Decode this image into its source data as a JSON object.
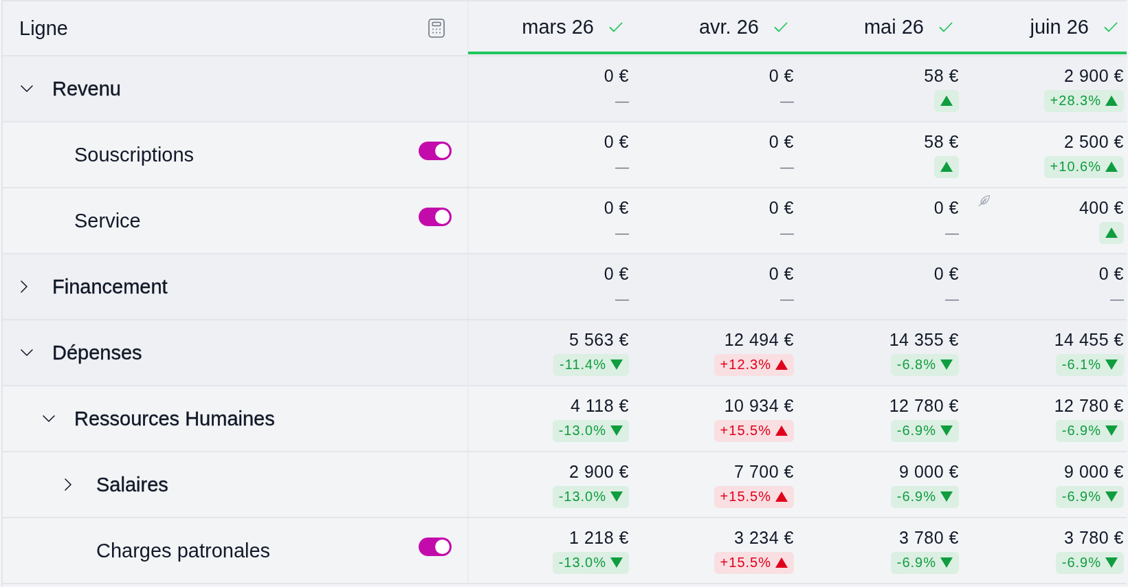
{
  "table": {
    "header": {
      "label": "Ligne"
    },
    "months": [
      {
        "label": "mars 26",
        "validated": true
      },
      {
        "label": "avr. 26",
        "validated": true
      },
      {
        "label": "mai 26",
        "validated": true
      },
      {
        "label": "juin 26",
        "validated": true
      }
    ],
    "rows": [
      {
        "label": "Revenu",
        "kind": "group",
        "expanded": true,
        "cells": [
          {
            "value": "0 €",
            "trend": {
              "kind": "none",
              "text": "—"
            },
            "edited": false
          },
          {
            "value": "0 €",
            "trend": {
              "kind": "none",
              "text": "—"
            },
            "edited": false
          },
          {
            "value": "58 €",
            "trend": {
              "kind": "up",
              "favorable": true
            },
            "edited": false
          },
          {
            "value": "2 900 €",
            "trend": {
              "kind": "up",
              "favorable": true,
              "text": "+28.3%"
            },
            "edited": false
          }
        ],
        "children": [
          {
            "label": "Souscriptions",
            "kind": "line",
            "enabled": true,
            "cells": [
              {
                "value": "0 €",
                "trend": {
                  "kind": "none",
                  "text": "—"
                },
                "edited": false
              },
              {
                "value": "0 €",
                "trend": {
                  "kind": "none",
                  "text": "—"
                },
                "edited": false
              },
              {
                "value": "58 €",
                "trend": {
                  "kind": "up",
                  "favorable": true
                },
                "edited": false
              },
              {
                "value": "2 500 €",
                "trend": {
                  "kind": "up",
                  "favorable": true,
                  "text": "+10.6%"
                },
                "edited": false
              }
            ]
          },
          {
            "label": "Service",
            "kind": "line",
            "enabled": true,
            "cells": [
              {
                "value": "0 €",
                "trend": {
                  "kind": "none",
                  "text": "—"
                },
                "edited": false
              },
              {
                "value": "0 €",
                "trend": {
                  "kind": "none",
                  "text": "—"
                },
                "edited": false
              },
              {
                "value": "0 €",
                "trend": {
                  "kind": "none",
                  "text": "—"
                },
                "edited": false
              },
              {
                "value": "400 €",
                "trend": {
                  "kind": "up",
                  "favorable": true
                },
                "edited": true
              }
            ]
          }
        ]
      },
      {
        "label": "Financement",
        "kind": "group",
        "expanded": false,
        "cells": [
          {
            "value": "0 €",
            "trend": {
              "kind": "none",
              "text": "—"
            },
            "edited": false
          },
          {
            "value": "0 €",
            "trend": {
              "kind": "none",
              "text": "—"
            },
            "edited": false
          },
          {
            "value": "0 €",
            "trend": {
              "kind": "none",
              "text": "—"
            },
            "edited": false
          },
          {
            "value": "0 €",
            "trend": {
              "kind": "none",
              "text": "—"
            },
            "edited": false
          }
        ]
      },
      {
        "label": "Dépenses",
        "kind": "group",
        "expanded": true,
        "cells": [
          {
            "value": "5 563 €",
            "trend": {
              "kind": "down",
              "favorable": true,
              "text": "-11.4%"
            },
            "edited": false
          },
          {
            "value": "12 494 €",
            "trend": {
              "kind": "up",
              "favorable": false,
              "text": "+12.3%"
            },
            "edited": false
          },
          {
            "value": "14 355 €",
            "trend": {
              "kind": "down",
              "favorable": true,
              "text": "-6.8%"
            },
            "edited": false
          },
          {
            "value": "14 455 €",
            "trend": {
              "kind": "down",
              "favorable": true,
              "text": "-6.1%"
            },
            "edited": false
          }
        ],
        "children": [
          {
            "label": "Ressources Humaines",
            "kind": "group",
            "expanded": true,
            "cells": [
              {
                "value": "4 118 €",
                "trend": {
                  "kind": "down",
                  "favorable": true,
                  "text": "-13.0%"
                },
                "edited": false
              },
              {
                "value": "10 934 €",
                "trend": {
                  "kind": "up",
                  "favorable": false,
                  "text": "+15.5%"
                },
                "edited": false
              },
              {
                "value": "12 780 €",
                "trend": {
                  "kind": "down",
                  "favorable": true,
                  "text": "-6.9%"
                },
                "edited": false
              },
              {
                "value": "12 780 €",
                "trend": {
                  "kind": "down",
                  "favorable": true,
                  "text": "-6.9%"
                },
                "edited": false
              }
            ],
            "children": [
              {
                "label": "Salaires",
                "kind": "group",
                "expanded": false,
                "cells": [
                  {
                    "value": "2 900 €",
                    "trend": {
                      "kind": "down",
                      "favorable": true,
                      "text": "-13.0%"
                    },
                    "edited": false
                  },
                  {
                    "value": "7 700 €",
                    "trend": {
                      "kind": "up",
                      "favorable": false,
                      "text": "+15.5%"
                    },
                    "edited": false
                  },
                  {
                    "value": "9 000 €",
                    "trend": {
                      "kind": "down",
                      "favorable": true,
                      "text": "-6.9%"
                    },
                    "edited": false
                  },
                  {
                    "value": "9 000 €",
                    "trend": {
                      "kind": "down",
                      "favorable": true,
                      "text": "-6.9%"
                    },
                    "edited": false
                  }
                ]
              },
              {
                "label": "Charges patronales",
                "kind": "line",
                "enabled": true,
                "cells": [
                  {
                    "value": "1 218 €",
                    "trend": {
                      "kind": "down",
                      "favorable": true,
                      "text": "-13.0%"
                    },
                    "edited": false
                  },
                  {
                    "value": "3 234 €",
                    "trend": {
                      "kind": "up",
                      "favorable": false,
                      "text": "+15.5%"
                    },
                    "edited": false
                  },
                  {
                    "value": "3 780 €",
                    "trend": {
                      "kind": "down",
                      "favorable": true,
                      "text": "-6.9%"
                    },
                    "edited": false
                  },
                  {
                    "value": "3 780 €",
                    "trend": {
                      "kind": "down",
                      "favorable": true,
                      "text": "-6.9%"
                    },
                    "edited": false
                  }
                ]
              }
            ]
          }
        ]
      }
    ]
  }
}
